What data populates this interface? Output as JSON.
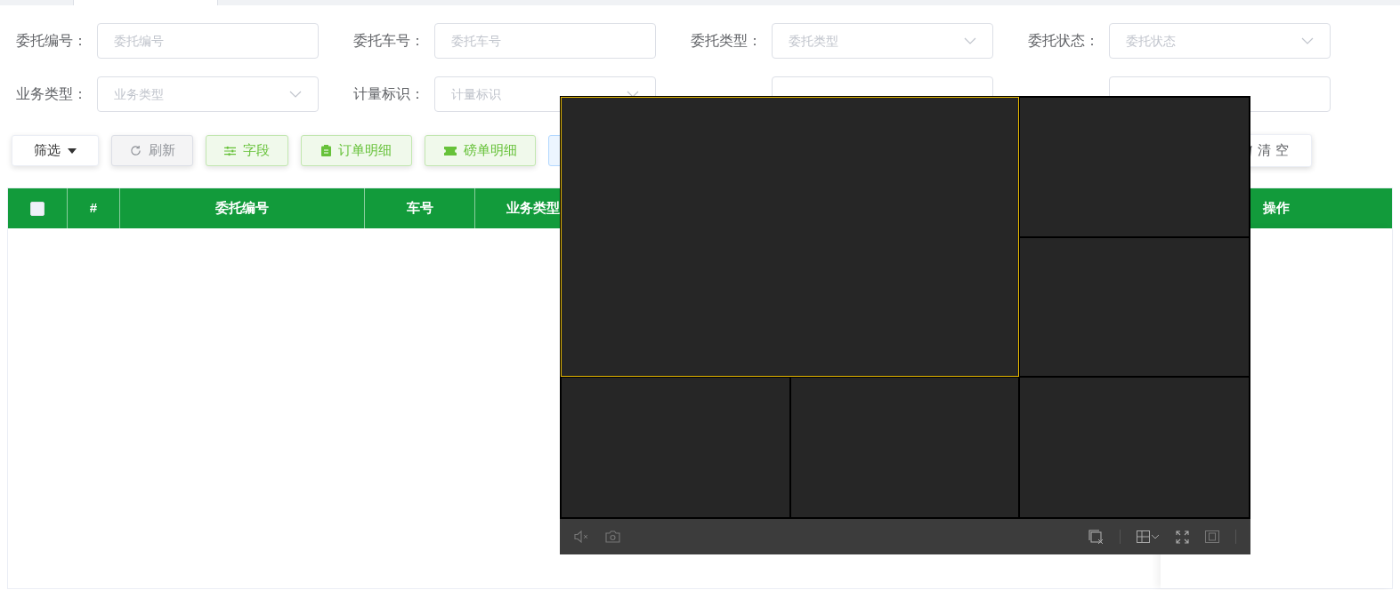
{
  "filters": [
    {
      "label": "委托编号：",
      "kind": "text",
      "placeholder": "委托编号"
    },
    {
      "label": "委托车号：",
      "kind": "text",
      "placeholder": "委托车号"
    },
    {
      "label": "委托类型：",
      "kind": "select",
      "placeholder": "委托类型"
    },
    {
      "label": "委托状态：",
      "kind": "select",
      "placeholder": "委托状态"
    },
    {
      "label": "业务类型：",
      "kind": "select",
      "placeholder": "业务类型"
    },
    {
      "label": "计量标识：",
      "kind": "select",
      "placeholder": "计量标识"
    },
    {
      "kind": "date"
    },
    {
      "kind": "date"
    }
  ],
  "toolbar": [
    {
      "label": "筛选",
      "kind": "dropdown"
    },
    {
      "label": "刷新",
      "kind": "refresh"
    },
    {
      "label": "字段",
      "kind": "fields"
    },
    {
      "label": "订单明细",
      "kind": "order"
    },
    {
      "label": "磅单明细",
      "kind": "ticket"
    }
  ],
  "clear_button": "清 空",
  "table": {
    "columns": [
      "#",
      "委托编号",
      "车号",
      "业务类型"
    ],
    "action_column": "操作",
    "select_all_checked": false
  },
  "video_player": {
    "cells": [
      {
        "selected": true
      },
      {
        "selected": false
      },
      {
        "selected": false
      },
      {
        "selected": false
      },
      {
        "selected": false
      },
      {
        "selected": false
      }
    ]
  }
}
